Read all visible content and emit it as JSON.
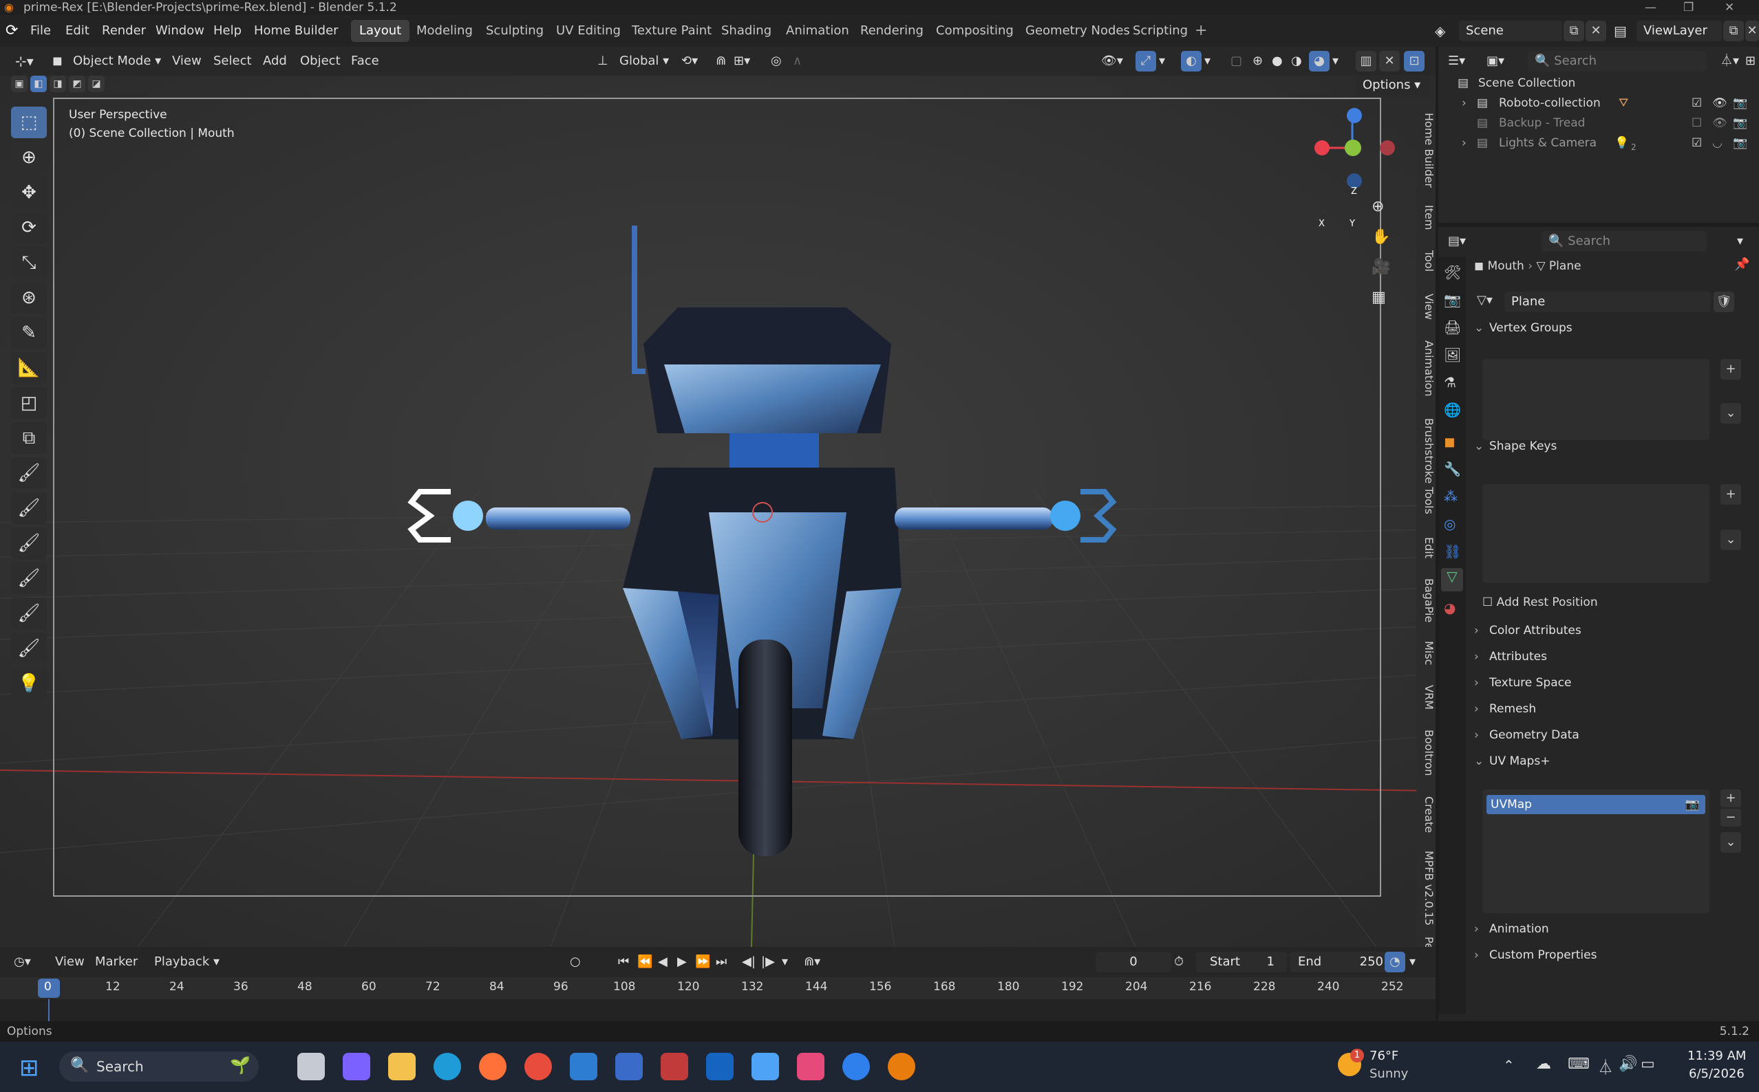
{
  "window": {
    "title": "prime-Rex [E:\\Blender-Projects\\prime-Rex.blend] - Blender 5.1.2"
  },
  "menu": {
    "items": [
      "File",
      "Edit",
      "Render",
      "Window",
      "Help",
      "Home Builder"
    ]
  },
  "workspaces": [
    "Layout",
    "Modeling",
    "Sculpting",
    "UV Editing",
    "Texture Paint",
    "Shading",
    "Animation",
    "Rendering",
    "Compositing",
    "Geometry Nodes",
    "Scripting"
  ],
  "scene": {
    "name": "Scene",
    "view_layer": "ViewLayer"
  },
  "viewport_header": {
    "mode": "Object Mode",
    "menus": [
      "View",
      "Select",
      "Add",
      "Object",
      "Face"
    ],
    "transform": "Global",
    "options": "Options"
  },
  "viewport": {
    "perspective": "User Perspective",
    "collection_info": "(0) Scene Collection | Mouth",
    "gizmo": {
      "x": "X",
      "y": "Y",
      "z": "Z"
    },
    "side_tabs": [
      "Home Builder",
      "Item",
      "Tool",
      "View",
      "Animation",
      "Brushstroke Tools",
      "Edit",
      "BagaPie",
      "Misc",
      "VRM",
      "Booltron",
      "Create",
      "MPFB v2.0.15",
      "Per"
    ]
  },
  "timeline": {
    "menus": [
      "View",
      "Marker",
      "Playback"
    ],
    "current_frame": "0",
    "start_label": "Start",
    "start": "1",
    "end_label": "End",
    "end": "250",
    "ruler": [
      "0",
      "12",
      "24",
      "36",
      "48",
      "60",
      "72",
      "84",
      "96",
      "108",
      "120",
      "132",
      "144",
      "156",
      "168",
      "180",
      "192",
      "204",
      "216",
      "228",
      "240",
      "252"
    ]
  },
  "status": {
    "left": "Options",
    "version": "5.1.2"
  },
  "outliner": {
    "search_placeholder": "Search",
    "root": "Scene Collection",
    "items": [
      {
        "label": "Roboto-collection",
        "enabled": true
      },
      {
        "label": "Backup - Tread",
        "enabled": false
      },
      {
        "label": "Lights & Camera",
        "enabled": true,
        "badge": "2"
      }
    ]
  },
  "properties": {
    "search_placeholder": "Search",
    "breadcrumb": {
      "object": "Mouth",
      "data": "Plane"
    },
    "mesh_name": "Plane",
    "panels": {
      "vertex_groups": "Vertex Groups",
      "shape_keys": "Shape Keys",
      "add_rest_position": "Add Rest Position",
      "color_attributes": "Color Attributes",
      "attributes": "Attributes",
      "texture_space": "Texture Space",
      "remesh": "Remesh",
      "geometry_data": "Geometry Data",
      "uv_maps": "UV Maps+",
      "uv_map_item": "UVMap",
      "animation": "Animation",
      "custom_properties": "Custom Properties"
    }
  },
  "taskbar": {
    "search": "Search",
    "weather_temp": "76°F",
    "weather_desc": "Sunny",
    "weather_badge": "1",
    "time": "11:39 AM",
    "date": "6/5/2026"
  },
  "colors": {
    "accent": "#4772b3",
    "selected": "#4a6fa5",
    "axis_x": "#e8404c",
    "axis_y": "#8ac43f",
    "axis_z": "#3f7fe0"
  }
}
